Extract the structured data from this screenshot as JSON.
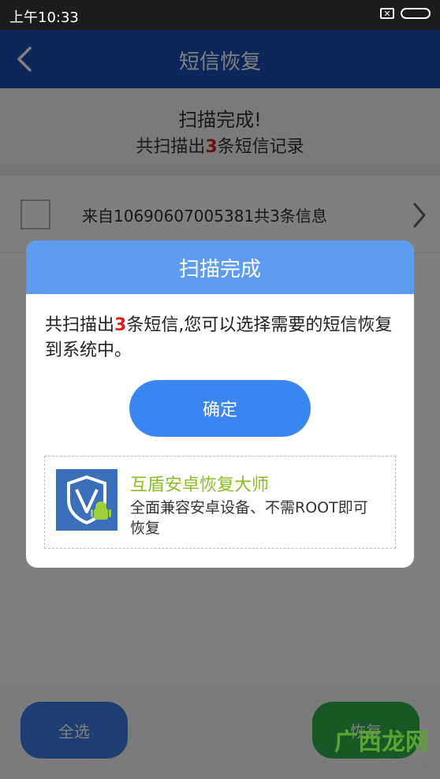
{
  "status_bar": {
    "time": "上午10:33",
    "sim_icon": "sim-off-icon",
    "battery_icon": "battery-icon"
  },
  "app_bar": {
    "back_icon": "back-arrow-icon",
    "title": "短信恢复"
  },
  "scan_summary": {
    "title": "扫描完成!",
    "line_prefix": "共扫描出",
    "count": "3",
    "line_suffix": "条短信记录"
  },
  "message_list": [
    {
      "label": "来自10690607005381共3条信息"
    }
  ],
  "bottom": {
    "select_all": "全选",
    "restore": "恢复"
  },
  "dialog": {
    "title": "扫描完成",
    "message_prefix": "共扫描出",
    "message_count": "3",
    "message_suffix": "条短信,您可以选择需要的短信恢复到系统中。",
    "ok_label": "确定",
    "promo": {
      "title": "互盾安卓恢复大师",
      "description": "全面兼容安卓设备、不需ROOT即可恢复"
    }
  },
  "watermark": {
    "main": "广西龙网",
    "sub": "百度旗下品牌"
  },
  "colors": {
    "app_bar": "#1d4fb7",
    "dialog_header": "#5d9cf0",
    "ok_button": "#3b86ee",
    "count_red": "#d9231d",
    "promo_title": "#8bbd28"
  }
}
